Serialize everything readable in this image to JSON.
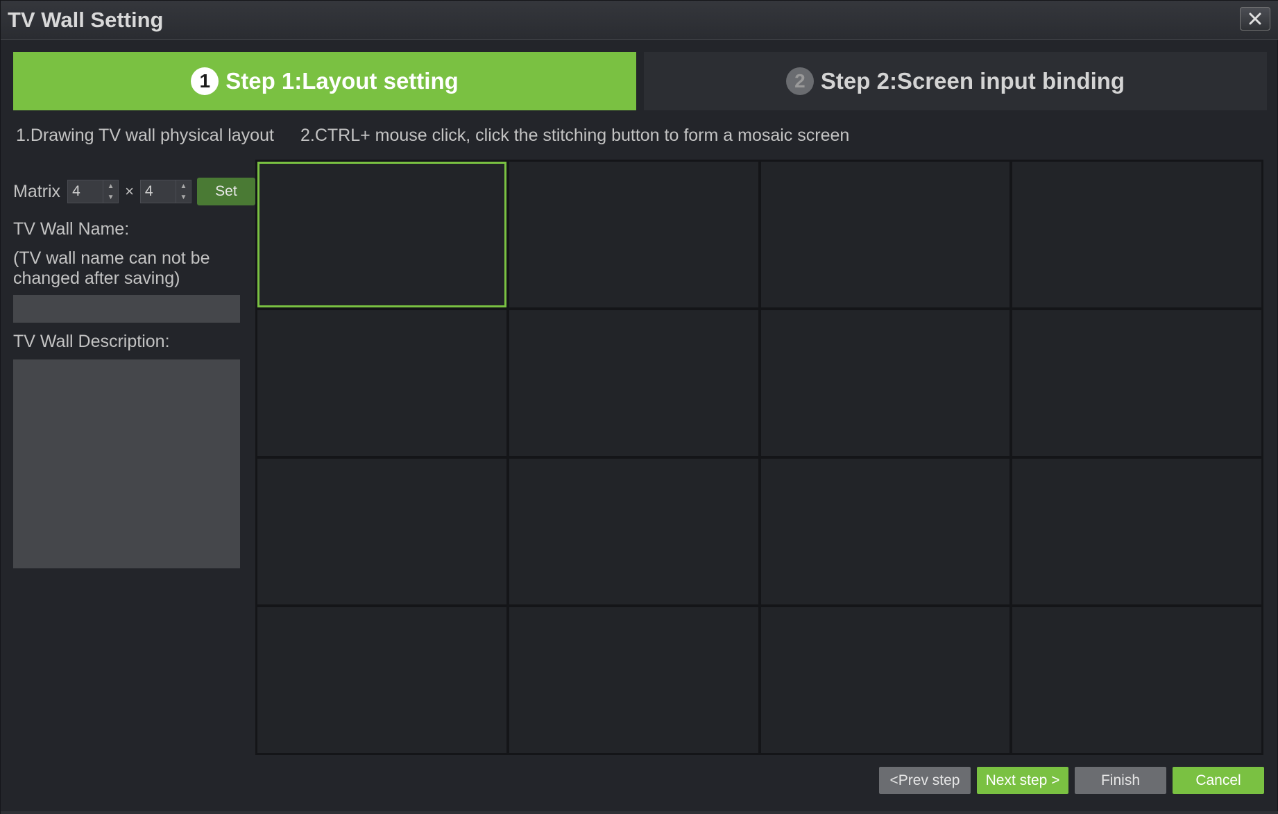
{
  "window": {
    "title": "TV Wall Setting"
  },
  "steps": [
    {
      "number": "1",
      "label": "Step 1:Layout setting",
      "active": true
    },
    {
      "number": "2",
      "label": "Step 2:Screen input binding",
      "active": false
    }
  ],
  "hints": {
    "hint1": "1.Drawing TV wall physical layout",
    "hint2": "2.CTRL+ mouse click, click the stitching button to form a mosaic screen"
  },
  "matrix": {
    "label": "Matrix",
    "rows": "4",
    "times": "×",
    "cols": "4",
    "set_label": "Set"
  },
  "form": {
    "name_label": "TV Wall Name:",
    "name_note": "(TV wall name can not be changed after saving)",
    "name_value": "",
    "description_label": "TV Wall Description:",
    "description_value": ""
  },
  "grid": {
    "rows": 4,
    "cols": 4,
    "selected_index": 0
  },
  "footer": {
    "prev_label": "<Prev step",
    "next_label": "Next step >",
    "finish_label": "Finish",
    "cancel_label": "Cancel"
  },
  "colors": {
    "accent": "#7ac142",
    "background": "#23252a",
    "cell": "#222428"
  }
}
